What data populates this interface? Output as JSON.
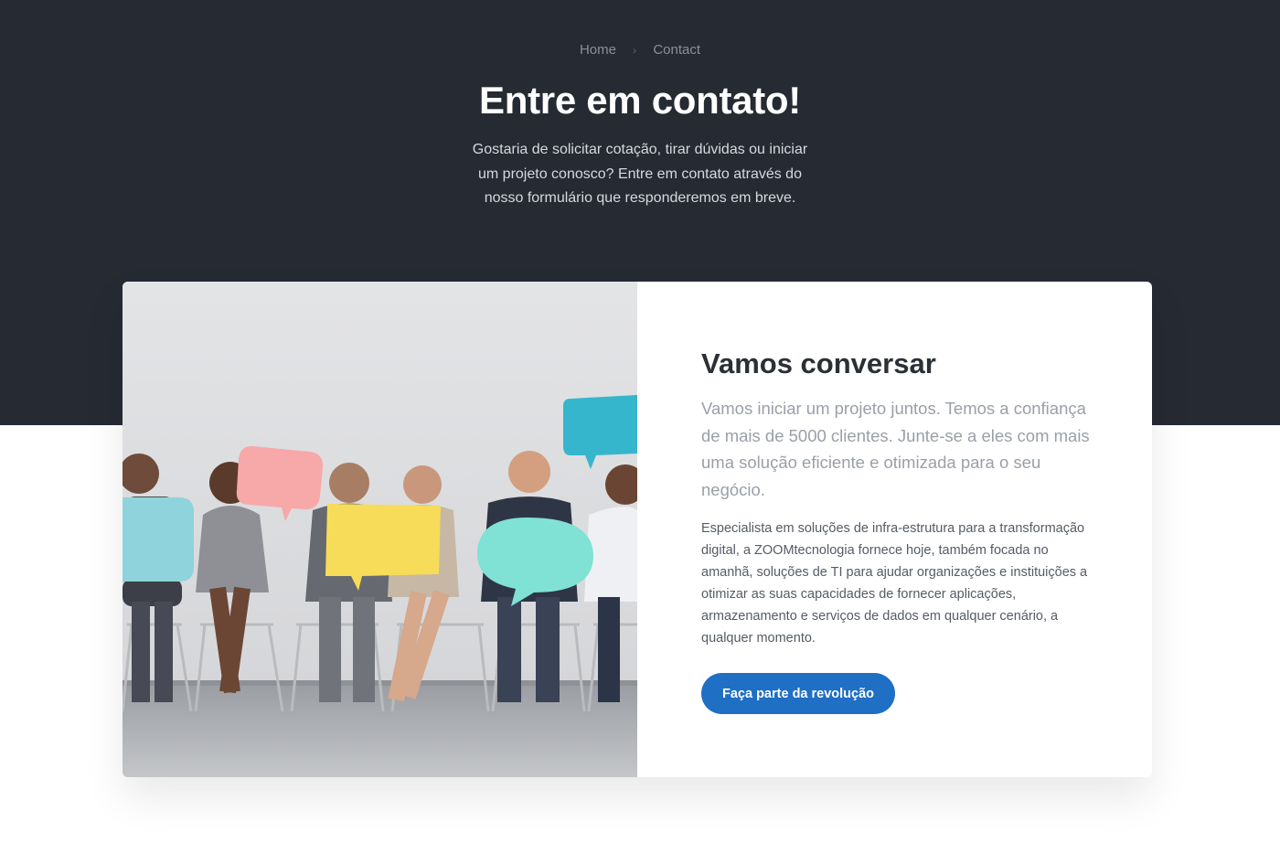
{
  "breadcrumb": {
    "home": "Home",
    "separator": "›",
    "current": "Contact"
  },
  "hero": {
    "title": "Entre em contato!",
    "subtitle": "Gostaria de solicitar cotação, tirar dúvidas ou iniciar um projeto conosco? Entre em contato através do nosso formulário que responderemos em breve."
  },
  "card": {
    "title": "Vamos conversar",
    "lead": "Vamos iniciar um projeto juntos. Temos a confiança de mais de 5000 clientes. Junte-se a eles com mais uma solução eficiente e otimizada para o seu negócio.",
    "body": "Especialista em soluções de infra-estrutura para a transformação digital, a ZOOMtecnologia fornece hoje, também focada no amanhã, soluções de TI para ajudar organizações e instituições a otimizar as suas capacidades de fornecer aplicações, armazenamento e serviços de dados em qualquer cenário, a qualquer momento.",
    "cta_label": "Faça parte da revolução"
  },
  "colors": {
    "hero_bg": "#252a33",
    "accent": "#1f6fc5"
  }
}
